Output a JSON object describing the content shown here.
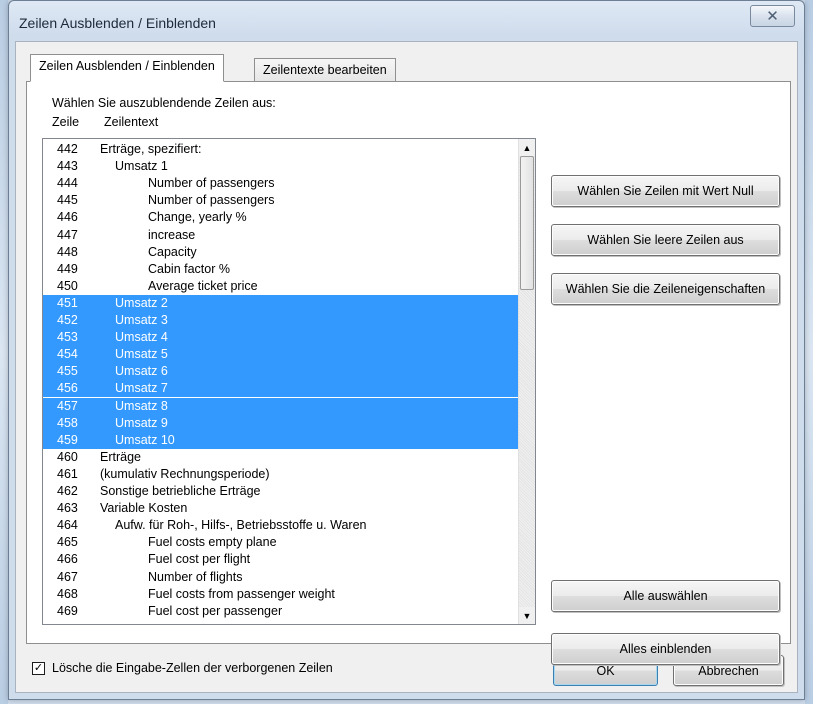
{
  "window": {
    "title": "Zeilen Ausblenden / Einblenden",
    "close_glyph": "✕"
  },
  "tabs": [
    {
      "label": "Zeilen Ausblenden / Einblenden"
    },
    {
      "label": "Zeilentexte bearbeiten"
    }
  ],
  "panel": {
    "instruction": "Wählen Sie auszublendende Zeilen aus:",
    "col_row": "Zeile",
    "col_text": "Zeilentext"
  },
  "rows": [
    {
      "num": "442",
      "text": "Erträge, spezifiert:",
      "indent": 0,
      "selected": false
    },
    {
      "num": "443",
      "text": "Umsatz 1",
      "indent": 1,
      "selected": false
    },
    {
      "num": "444",
      "text": "Number of passengers",
      "indent": 2,
      "selected": false
    },
    {
      "num": "445",
      "text": "Number of passengers",
      "indent": 2,
      "selected": false
    },
    {
      "num": "446",
      "text": "Change, yearly %",
      "indent": 2,
      "selected": false
    },
    {
      "num": "447",
      "text": "increase",
      "indent": 2,
      "selected": false
    },
    {
      "num": "448",
      "text": "Capacity",
      "indent": 2,
      "selected": false
    },
    {
      "num": "449",
      "text": "Cabin factor %",
      "indent": 2,
      "selected": false
    },
    {
      "num": "450",
      "text": "Average ticket price",
      "indent": 2,
      "selected": false
    },
    {
      "num": "451",
      "text": "Umsatz 2",
      "indent": 1,
      "selected": true
    },
    {
      "num": "452",
      "text": "Umsatz 3",
      "indent": 1,
      "selected": true
    },
    {
      "num": "453",
      "text": "Umsatz 4",
      "indent": 1,
      "selected": true
    },
    {
      "num": "454",
      "text": "Umsatz 5",
      "indent": 1,
      "selected": true
    },
    {
      "num": "455",
      "text": "Umsatz 6",
      "indent": 1,
      "selected": true
    },
    {
      "num": "456",
      "text": "Umsatz 7",
      "indent": 1,
      "selected": true
    },
    {
      "num": "457",
      "text": "Umsatz 8",
      "indent": 1,
      "selected": true
    },
    {
      "num": "458",
      "text": "Umsatz 9",
      "indent": 1,
      "selected": true
    },
    {
      "num": "459",
      "text": "Umsatz 10",
      "indent": 1,
      "selected": true
    },
    {
      "num": "460",
      "text": "Erträge",
      "indent": 0,
      "selected": false
    },
    {
      "num": "461",
      "text": "(kumulativ Rechnungsperiode)",
      "indent": 0,
      "selected": false
    },
    {
      "num": "462",
      "text": "Sonstige betriebliche Erträge",
      "indent": 0,
      "selected": false
    },
    {
      "num": "463",
      "text": "Variable Kosten",
      "indent": 0,
      "selected": false
    },
    {
      "num": "464",
      "text": "Aufw. für Roh-, Hilfs-, Betriebsstoffe u. Waren",
      "indent": 1,
      "selected": false
    },
    {
      "num": "465",
      "text": "Fuel costs empty plane",
      "indent": 2,
      "selected": false
    },
    {
      "num": "466",
      "text": "Fuel cost per flight",
      "indent": 2,
      "selected": false
    },
    {
      "num": "467",
      "text": "Number of flights",
      "indent": 2,
      "selected": false
    },
    {
      "num": "468",
      "text": "Fuel costs from passenger weight",
      "indent": 2,
      "selected": false
    },
    {
      "num": "469",
      "text": "Fuel cost per passenger",
      "indent": 2,
      "selected": false
    }
  ],
  "side_buttons": {
    "select_zero": "Wählen Sie Zeilen mit Wert Null",
    "select_empty": "Wählen Sie leere Zeilen aus",
    "select_props": "Wählen Sie die Zeileneigenschaften",
    "select_all": "Alle auswählen",
    "show_all": "Alles einblenden"
  },
  "scrollbar": {
    "up_glyph": "▲",
    "down_glyph": "▼"
  },
  "footer": {
    "checkbox_label": "Lösche die Eingabe-Zellen der verborgenen Zeilen",
    "checkbox_checked": true,
    "check_glyph": "✓",
    "ok": "OK",
    "cancel": "Abbrechen"
  },
  "colors": {
    "selection": "#3399ff",
    "selection_text": "#ffffff"
  }
}
